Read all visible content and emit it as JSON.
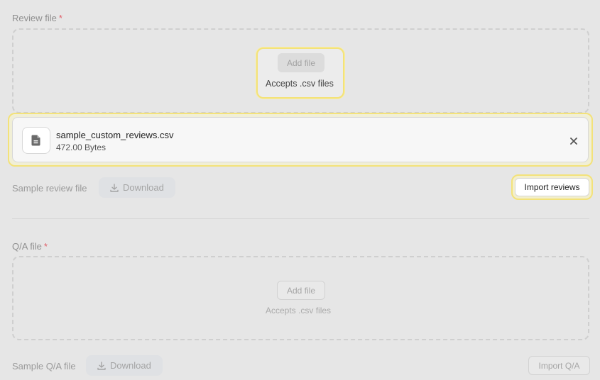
{
  "review_section": {
    "label": "Review file",
    "required_mark": "*",
    "add_file_label": "Add file",
    "accepts_hint": "Accepts .csv files",
    "file": {
      "name": "sample_custom_reviews.csv",
      "size": "472.00 Bytes",
      "icon": "document-icon",
      "remove_icon": "close-icon"
    },
    "sample_label": "Sample review file",
    "download_label": "Download",
    "import_label": "Import reviews"
  },
  "qa_section": {
    "label": "Q/A file",
    "required_mark": "*",
    "add_file_label": "Add file",
    "accepts_hint": "Accepts .csv files",
    "sample_label": "Sample Q/A file",
    "download_label": "Download",
    "import_label": "Import Q/A"
  },
  "colors": {
    "highlight": "#f3e27a",
    "required": "#e0606a",
    "background": "#e6e6e6"
  }
}
